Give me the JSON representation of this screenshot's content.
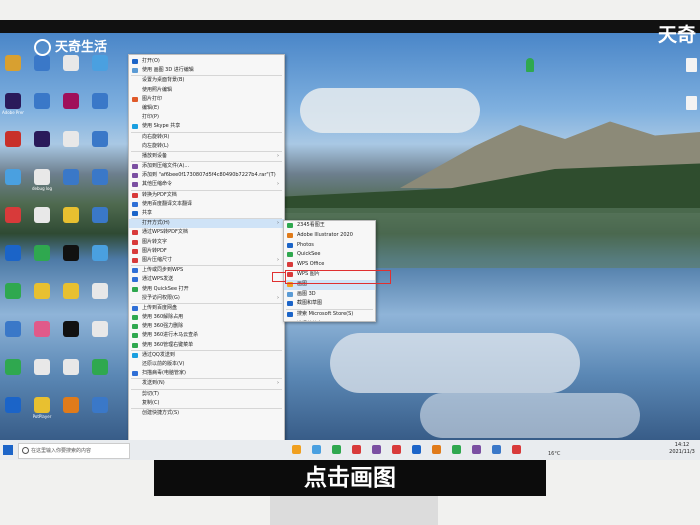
{
  "watermark": {
    "left": "天奇生活",
    "right": "天奇"
  },
  "subtitle": "点击画图",
  "context_menu": {
    "items": [
      {
        "label": "打开(O)",
        "icon": "open-icon",
        "color": "#1b64c8"
      },
      {
        "label": "使用 画图 3D 进行编辑",
        "icon": "paint3d-icon",
        "color": "#5b9bd5"
      },
      {
        "label": "设置为桌面背景(B)",
        "icon": "",
        "color": ""
      },
      {
        "label": "使用照片编辑",
        "icon": "",
        "color": ""
      },
      {
        "label": "图片打印",
        "icon": "print-icon",
        "color": "#e05a2a"
      },
      {
        "label": "编辑(E)",
        "icon": "",
        "color": ""
      },
      {
        "label": "打印(P)",
        "icon": "",
        "color": ""
      },
      {
        "label": "使用 Skype 共享",
        "icon": "skype-icon",
        "color": "#1a9fe0"
      },
      {
        "label": "向右旋转(R)",
        "icon": "",
        "color": ""
      },
      {
        "label": "向左旋转(L)",
        "icon": "",
        "color": ""
      },
      {
        "label": "播放到设备",
        "icon": "",
        "color": "",
        "arrow": true
      },
      {
        "label": "添加到压缩文件(A)...",
        "icon": "archive-icon",
        "color": "#7b4fa2"
      },
      {
        "label": "添加到 \"af6bee0f1730807d5f4c80490b7227b4.rar\"(T)",
        "icon": "archive-icon",
        "color": "#7b4fa2"
      },
      {
        "label": "其他压缩命令",
        "icon": "archive-icon",
        "color": "#7b4fa2",
        "arrow": true
      },
      {
        "label": "转换为PDF文档",
        "icon": "pdf-icon",
        "color": "#d83a3a"
      },
      {
        "label": "使用百度翻译文本翻译",
        "icon": "translate-icon",
        "color": "#2f6fd6"
      },
      {
        "label": "共享",
        "icon": "share-icon",
        "color": "#1b64c8"
      },
      {
        "label": "打开方式(H)",
        "icon": "",
        "color": "",
        "arrow": true
      },
      {
        "label": "通过WPS转PDF文档",
        "icon": "wps-icon",
        "color": "#d83a3a"
      },
      {
        "label": "图片转文字",
        "icon": "ocr-icon",
        "color": "#d83a3a"
      },
      {
        "label": "图片转PDF",
        "icon": "pdf-icon",
        "color": "#d83a3a"
      },
      {
        "label": "图片压缩尺寸",
        "icon": "compress-icon",
        "color": "#d83a3a",
        "arrow": true
      },
      {
        "label": "上传或同步到WPS",
        "icon": "cloud-icon",
        "color": "#2f6fd6"
      },
      {
        "label": "通过WPS发送",
        "icon": "send-icon",
        "color": "#2f6fd6"
      },
      {
        "label": "使用 QuickSee 打开",
        "icon": "quicksee-icon",
        "color": "#2fa84f"
      },
      {
        "label": "授予访问权限(G)",
        "icon": "",
        "color": "",
        "arrow": true
      },
      {
        "label": "上传到百度网盘",
        "icon": "baidu-icon",
        "color": "#2f6fd6"
      },
      {
        "label": "使用 360解除占用",
        "icon": "360-icon",
        "color": "#2fa84f"
      },
      {
        "label": "使用 360强力删除",
        "icon": "360-icon",
        "color": "#2fa84f"
      },
      {
        "label": "使用 360进行木马云查杀",
        "icon": "360-icon",
        "color": "#2fa84f"
      },
      {
        "label": "使用 360管理右键菜单",
        "icon": "360-icon",
        "color": "#2fa84f"
      },
      {
        "label": "通过QQ发送到",
        "icon": "qq-icon",
        "color": "#1a9fe0"
      },
      {
        "label": "还原以前的版本(V)",
        "icon": "",
        "color": ""
      },
      {
        "label": "扫描病毒(电脑管家)",
        "icon": "shield-icon",
        "color": "#2f6fd6"
      },
      {
        "label": "发送到(N)",
        "icon": "",
        "color": "",
        "arrow": true
      },
      {
        "label": "剪切(T)",
        "icon": "",
        "color": ""
      },
      {
        "label": "复制(C)",
        "icon": "",
        "color": ""
      },
      {
        "label": "创建快捷方式(S)",
        "icon": "",
        "color": ""
      }
    ]
  },
  "open_with_submenu": {
    "items": [
      {
        "label": "2345看图王",
        "color": "#2fa84f"
      },
      {
        "label": "Adobe Illustrator 2020",
        "color": "#e07b1a"
      },
      {
        "label": "Photos",
        "color": "#1b64c8"
      },
      {
        "label": "QuickSee",
        "color": "#2fa84f"
      },
      {
        "label": "WPS Office",
        "color": "#d83a3a"
      },
      {
        "label": "WPS 图片",
        "color": "#d83a3a"
      },
      {
        "label": "画图",
        "color": "#f0a020"
      },
      {
        "label": "画图 3D",
        "color": "#5b9bd5"
      },
      {
        "label": "截图和草图",
        "color": "#1b64c8"
      },
      {
        "label": "搜索 Microsoft Store(S)",
        "color": "#1b64c8"
      },
      {
        "label": "选择其他应用(C)",
        "color": ""
      }
    ]
  },
  "taskbar": {
    "search_placeholder": "在这里输入你要搜索的内容",
    "temperature": "16°C",
    "clock_time": "14:12",
    "clock_date": "2021/11/3"
  },
  "desktop_icons": [
    {
      "label": "",
      "color": "#d8a030"
    },
    {
      "label": "",
      "color": "#3a78c8"
    },
    {
      "label": "",
      "color": "#e8e8e8"
    },
    {
      "label": "",
      "color": "#4aa0e0"
    },
    {
      "label": "Adobe Premiere",
      "color": "#2a1a5a"
    },
    {
      "label": "",
      "color": "#3a78c8"
    },
    {
      "label": "",
      "color": "#a0105a"
    },
    {
      "label": "",
      "color": "#3a78c8"
    },
    {
      "label": "",
      "color": "#c8302a"
    },
    {
      "label": "",
      "color": "#2a1a5a"
    },
    {
      "label": "",
      "color": "#e8e8e8"
    },
    {
      "label": "",
      "color": "#3a78c8"
    },
    {
      "label": "",
      "color": "#4aa0e0"
    },
    {
      "label": "debug log",
      "color": "#e8e8e8"
    },
    {
      "label": "",
      "color": "#3a78c8"
    },
    {
      "label": "",
      "color": "#3a78c8"
    },
    {
      "label": "",
      "color": "#d83a3a"
    },
    {
      "label": "",
      "color": "#e8e8e8"
    },
    {
      "label": "",
      "color": "#e8c030"
    },
    {
      "label": "",
      "color": "#3a78c8"
    },
    {
      "label": "",
      "color": "#1b64c8"
    },
    {
      "label": "",
      "color": "#2fa84f"
    },
    {
      "label": "",
      "color": "#111111"
    },
    {
      "label": "",
      "color": "#4aa0e0"
    },
    {
      "label": "",
      "color": "#2fa84f"
    },
    {
      "label": "",
      "color": "#e8c030"
    },
    {
      "label": "",
      "color": "#e8c030"
    },
    {
      "label": "",
      "color": "#e8e8e8"
    },
    {
      "label": "",
      "color": "#3a78c8"
    },
    {
      "label": "",
      "color": "#e05a8a"
    },
    {
      "label": "",
      "color": "#111111"
    },
    {
      "label": "",
      "color": "#e8e8e8"
    },
    {
      "label": "",
      "color": "#2fa84f"
    },
    {
      "label": "",
      "color": "#e8e8e8"
    },
    {
      "label": "",
      "color": "#e8e8e8"
    },
    {
      "label": "",
      "color": "#2fa84f"
    },
    {
      "label": "",
      "color": "#1b64c8"
    },
    {
      "label": "PotPlayer",
      "color": "#e8c030"
    },
    {
      "label": "",
      "color": "#e07b1a"
    },
    {
      "label": "",
      "color": "#3a78c8"
    }
  ]
}
